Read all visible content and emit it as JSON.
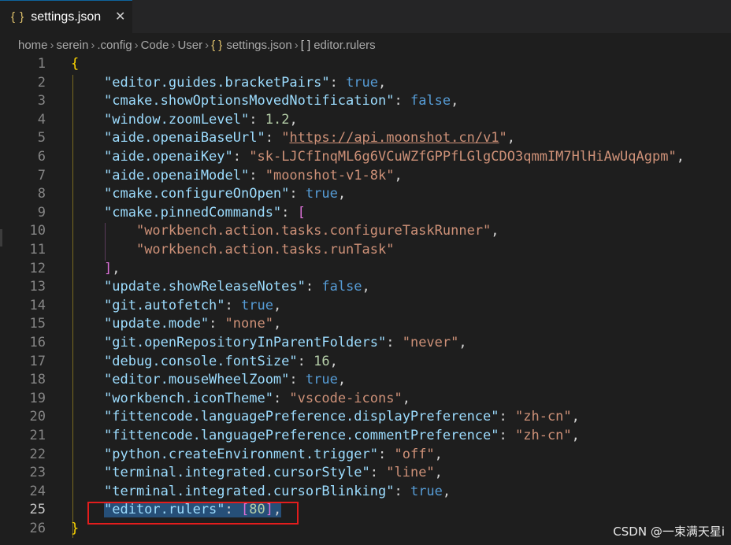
{
  "tab": {
    "icon": "json-braces-icon",
    "icon_text": "{ }",
    "label": "settings.json",
    "close": "✕"
  },
  "breadcrumb": {
    "items": [
      "home",
      "serein",
      ".config",
      "Code",
      "User"
    ],
    "file_icon": "{ }",
    "file": "settings.json",
    "array_icon": "[ ]",
    "symbol": "editor.rulers",
    "separator": "›"
  },
  "editor": {
    "active_line": 25,
    "lines": [
      {
        "n": "1",
        "t": [
          [
            "{",
            "br1"
          ]
        ]
      },
      {
        "n": "2",
        "t": [
          [
            "\"editor.guides.bracketPairs\"",
            "k"
          ],
          [
            ": ",
            "p"
          ],
          [
            "true",
            "b"
          ],
          [
            ",",
            "p"
          ]
        ]
      },
      {
        "n": "3",
        "t": [
          [
            "\"cmake.showOptionsMovedNotification\"",
            "k"
          ],
          [
            ": ",
            "p"
          ],
          [
            "false",
            "b"
          ],
          [
            ",",
            "p"
          ]
        ]
      },
      {
        "n": "4",
        "t": [
          [
            "\"window.zoomLevel\"",
            "k"
          ],
          [
            ": ",
            "p"
          ],
          [
            "1.2",
            "n"
          ],
          [
            ",",
            "p"
          ]
        ]
      },
      {
        "n": "5",
        "t": [
          [
            "\"aide.openaiBaseUrl\"",
            "k"
          ],
          [
            ": ",
            "p"
          ],
          [
            "\"",
            "s"
          ],
          [
            "https://api.moonshot.cn/v1",
            "s u"
          ],
          [
            "\"",
            "s"
          ],
          [
            ",",
            "p"
          ]
        ]
      },
      {
        "n": "6",
        "t": [
          [
            "\"aide.openaiKey\"",
            "k"
          ],
          [
            ": ",
            "p"
          ],
          [
            "\"sk-LJCfInqML6g6VCuWZfGPPfLGlgCDO3qmmIM7HlHiAwUqAgpm\"",
            "s"
          ],
          [
            ",",
            "p"
          ]
        ]
      },
      {
        "n": "7",
        "t": [
          [
            "\"aide.openaiModel\"",
            "k"
          ],
          [
            ": ",
            "p"
          ],
          [
            "\"moonshot-v1-8k\"",
            "s"
          ],
          [
            ",",
            "p"
          ]
        ]
      },
      {
        "n": "8",
        "t": [
          [
            "\"cmake.configureOnOpen\"",
            "k"
          ],
          [
            ": ",
            "p"
          ],
          [
            "true",
            "b"
          ],
          [
            ",",
            "p"
          ]
        ]
      },
      {
        "n": "9",
        "t": [
          [
            "\"cmake.pinnedCommands\"",
            "k"
          ],
          [
            ": ",
            "p"
          ],
          [
            "[",
            "br2"
          ]
        ]
      },
      {
        "n": "10",
        "t": [
          [
            "    ",
            "p"
          ],
          [
            "\"workbench.action.tasks.configureTaskRunner\"",
            "s"
          ],
          [
            ",",
            "p"
          ]
        ]
      },
      {
        "n": "11",
        "t": [
          [
            "    ",
            "p"
          ],
          [
            "\"workbench.action.tasks.runTask\"",
            "s"
          ]
        ]
      },
      {
        "n": "12",
        "t": [
          [
            "]",
            "br2"
          ],
          [
            ",",
            "p"
          ]
        ]
      },
      {
        "n": "13",
        "t": [
          [
            "\"update.showReleaseNotes\"",
            "k"
          ],
          [
            ": ",
            "p"
          ],
          [
            "false",
            "b"
          ],
          [
            ",",
            "p"
          ]
        ]
      },
      {
        "n": "14",
        "t": [
          [
            "\"git.autofetch\"",
            "k"
          ],
          [
            ": ",
            "p"
          ],
          [
            "true",
            "b"
          ],
          [
            ",",
            "p"
          ]
        ]
      },
      {
        "n": "15",
        "t": [
          [
            "\"update.mode\"",
            "k"
          ],
          [
            ": ",
            "p"
          ],
          [
            "\"none\"",
            "s"
          ],
          [
            ",",
            "p"
          ]
        ]
      },
      {
        "n": "16",
        "t": [
          [
            "\"git.openRepositoryInParentFolders\"",
            "k"
          ],
          [
            ": ",
            "p"
          ],
          [
            "\"never\"",
            "s"
          ],
          [
            ",",
            "p"
          ]
        ]
      },
      {
        "n": "17",
        "t": [
          [
            "\"debug.console.fontSize\"",
            "k"
          ],
          [
            ": ",
            "p"
          ],
          [
            "16",
            "n"
          ],
          [
            ",",
            "p"
          ]
        ]
      },
      {
        "n": "18",
        "t": [
          [
            "\"editor.mouseWheelZoom\"",
            "k"
          ],
          [
            ": ",
            "p"
          ],
          [
            "true",
            "b"
          ],
          [
            ",",
            "p"
          ]
        ]
      },
      {
        "n": "19",
        "t": [
          [
            "\"workbench.iconTheme\"",
            "k"
          ],
          [
            ": ",
            "p"
          ],
          [
            "\"vscode-icons\"",
            "s"
          ],
          [
            ",",
            "p"
          ]
        ]
      },
      {
        "n": "20",
        "t": [
          [
            "\"fittencode.languagePreference.displayPreference\"",
            "k"
          ],
          [
            ": ",
            "p"
          ],
          [
            "\"zh-cn\"",
            "s"
          ],
          [
            ",",
            "p"
          ]
        ]
      },
      {
        "n": "21",
        "t": [
          [
            "\"fittencode.languagePreference.commentPreference\"",
            "k"
          ],
          [
            ": ",
            "p"
          ],
          [
            "\"zh-cn\"",
            "s"
          ],
          [
            ",",
            "p"
          ]
        ]
      },
      {
        "n": "22",
        "t": [
          [
            "\"python.createEnvironment.trigger\"",
            "k"
          ],
          [
            ": ",
            "p"
          ],
          [
            "\"off\"",
            "s"
          ],
          [
            ",",
            "p"
          ]
        ]
      },
      {
        "n": "23",
        "t": [
          [
            "\"terminal.integrated.cursorStyle\"",
            "k"
          ],
          [
            ": ",
            "p"
          ],
          [
            "\"line\"",
            "s"
          ],
          [
            ",",
            "p"
          ]
        ]
      },
      {
        "n": "24",
        "t": [
          [
            "\"terminal.integrated.cursorBlinking\"",
            "k"
          ],
          [
            ": ",
            "p"
          ],
          [
            "true",
            "b"
          ],
          [
            ",",
            "p"
          ]
        ]
      },
      {
        "n": "25",
        "t": [
          [
            "\"editor.rulers\"",
            "k sel"
          ],
          [
            ": ",
            "p sel"
          ],
          [
            "[",
            "br2 sel"
          ],
          [
            "80",
            "n sel"
          ],
          [
            "]",
            "br2 sel"
          ],
          [
            ",",
            "p sel"
          ]
        ]
      },
      {
        "n": "26",
        "t": [
          [
            "}",
            "br1"
          ]
        ]
      }
    ]
  },
  "watermark": "CSDN @一束满天星i",
  "colors": {
    "background": "#1e1e1e",
    "property": "#9cdcfe",
    "string": "#ce9178",
    "boolean": "#569cd6",
    "number": "#b5cea8",
    "bracket_outer": "#ffd700",
    "bracket_inner": "#da70d6",
    "selection": "#264f78",
    "highlight_box": "#e21d1d"
  }
}
